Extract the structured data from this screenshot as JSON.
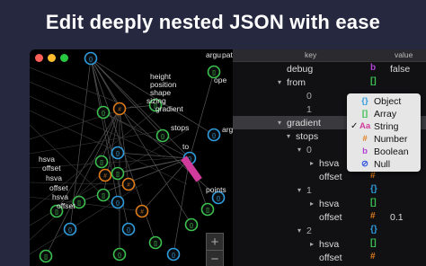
{
  "headline": "Edit deeply nested JSON with ease",
  "colors": {
    "close": "#ff5f57",
    "minimize": "#febc2e",
    "zoom": "#28c840",
    "string": "#d13b9b",
    "number": "#e07b1a",
    "boolean": "#b23fd6",
    "array": "#3bbf4f",
    "object": "#2e9cdd",
    "null": "#2f55e0"
  },
  "graph": {
    "labels": [
      "argu",
      "pattern",
      "height",
      "position",
      "shape",
      "sizing",
      "gradient",
      "stops",
      "to",
      "hsva",
      "offset",
      "hsva",
      "offset",
      "hsva",
      "offset",
      "points",
      "argu",
      "ope"
    ],
    "zoom_in": "+",
    "zoom_out": "−"
  },
  "tree": {
    "header": {
      "key": "key",
      "value": "value"
    },
    "rows": [
      {
        "key": "debug",
        "type": "b",
        "value": "false",
        "ind": 0,
        "arrow": ""
      },
      {
        "key": "from",
        "type": "[]",
        "value": "",
        "ind": 0,
        "arrow": "▾"
      },
      {
        "key": "0",
        "type": "",
        "value": "",
        "ind": 2,
        "arrow": "",
        "idx": true
      },
      {
        "key": "1",
        "type": "",
        "value": "",
        "ind": 2,
        "arrow": "",
        "idx": true
      },
      {
        "key": "gradient",
        "type": "",
        "value": "",
        "ind": 0,
        "arrow": "▾",
        "sel": true
      },
      {
        "key": "stops",
        "type": "[]",
        "value": "",
        "ind": 1,
        "arrow": "▾"
      },
      {
        "key": "0",
        "type": "{}",
        "value": "",
        "ind": 2,
        "arrow": "▾",
        "idx": true
      },
      {
        "key": "hsva",
        "type": "[]",
        "value": "",
        "ind": 3,
        "arrow": "▸"
      },
      {
        "key": "offset",
        "type": "#",
        "value": "",
        "ind": 3,
        "arrow": ""
      },
      {
        "key": "1",
        "type": "{}",
        "value": "",
        "ind": 2,
        "arrow": "▾",
        "idx": true
      },
      {
        "key": "hsva",
        "type": "[]",
        "value": "",
        "ind": 3,
        "arrow": "▸"
      },
      {
        "key": "offset",
        "type": "#",
        "value": "0.1",
        "ind": 3,
        "arrow": ""
      },
      {
        "key": "2",
        "type": "{}",
        "value": "",
        "ind": 2,
        "arrow": "▾",
        "idx": true
      },
      {
        "key": "hsva",
        "type": "[]",
        "value": "",
        "ind": 3,
        "arrow": "▸"
      },
      {
        "key": "offset",
        "type": "#",
        "value": "",
        "ind": 3,
        "arrow": ""
      }
    ]
  },
  "type_menu": [
    {
      "icon": "{}",
      "label": "Object",
      "color": "#2e9cdd",
      "checked": false
    },
    {
      "icon": "[]",
      "label": "Array",
      "color": "#3bbf4f",
      "checked": false
    },
    {
      "icon": "Aa",
      "label": "String",
      "color": "#d13b9b",
      "checked": true
    },
    {
      "icon": "#",
      "label": "Number",
      "color": "#e07b1a",
      "checked": false
    },
    {
      "icon": "b",
      "label": "Boolean",
      "color": "#b23fd6",
      "checked": false
    },
    {
      "icon": "⊘",
      "label": "Null",
      "color": "#2f55e0",
      "checked": false
    }
  ]
}
